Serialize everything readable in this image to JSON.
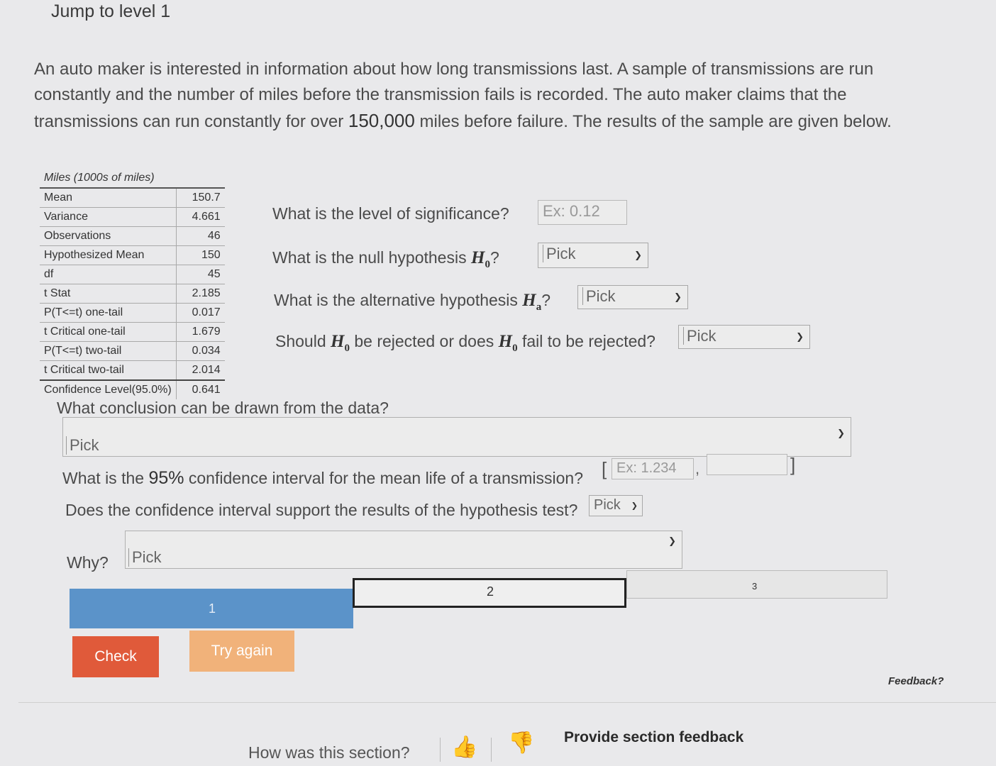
{
  "header": {
    "jump": "Jump to level 1"
  },
  "problem": {
    "part1": "An auto maker is interested in information about how long transmissions last. A sample of transmissions are run constantly and the number of miles before the transmission fails is recorded. The auto maker claims that the transmissions can run constantly for over ",
    "value": "150,000",
    "part2": " miles before failure. The results of the sample are given below."
  },
  "stats": {
    "header": "Miles (1000s of miles)",
    "rows": [
      {
        "label": "Mean",
        "value": "150.7"
      },
      {
        "label": "Variance",
        "value": "4.661"
      },
      {
        "label": "Observations",
        "value": "46"
      },
      {
        "label": "Hypothesized Mean",
        "value": "150"
      },
      {
        "label": "df",
        "value": "45"
      },
      {
        "label": "t Stat",
        "value": "2.185"
      },
      {
        "label": "P(T<=t) one-tail",
        "value": "0.017"
      },
      {
        "label": "t Critical one-tail",
        "value": "1.679"
      },
      {
        "label": "P(T<=t) two-tail",
        "value": "0.034"
      },
      {
        "label": "t Critical two-tail",
        "value": "2.014"
      },
      {
        "label": "Confidence Level(95.0%)",
        "value": "0.641"
      }
    ]
  },
  "questions": {
    "significance": {
      "label": "What is the level of significance?",
      "placeholder": "Ex: 0.12"
    },
    "null": {
      "label_pre": "What is the null hypothesis ",
      "symbol": "H",
      "sub": "0",
      "label_post": "?",
      "selected": "Pick"
    },
    "alt": {
      "label_pre": "What is the alternative hypothesis ",
      "symbol": "H",
      "sub": "a",
      "label_post": "?",
      "selected": "Pick"
    },
    "reject": {
      "pre": "Should ",
      "mid": " be rejected or does ",
      "post": " fail to be rejected?",
      "symbol": "H",
      "sub": "0",
      "selected": "Pick"
    },
    "conclusion": {
      "label": "What conclusion can be drawn from the data?",
      "selected": "Pick"
    },
    "ci": {
      "pre": "What is the ",
      "pct": "95%",
      "post": " confidence interval for the mean life of a transmission?",
      "open": "[",
      "placeholder1": "Ex: 1.234",
      "comma": ",",
      "close": "]"
    },
    "support": {
      "label": "Does the confidence interval support the results of the hypothesis test?",
      "selected": "Pick"
    },
    "why": {
      "label": "Why?",
      "selected": "Pick"
    }
  },
  "progress": {
    "seg1": "1",
    "seg2": "2",
    "seg3": "3"
  },
  "buttons": {
    "check": "Check",
    "retry": "Try again"
  },
  "footer": {
    "feedback": "Feedback?",
    "section_q": "How was this section?",
    "provide": "Provide section feedback"
  }
}
